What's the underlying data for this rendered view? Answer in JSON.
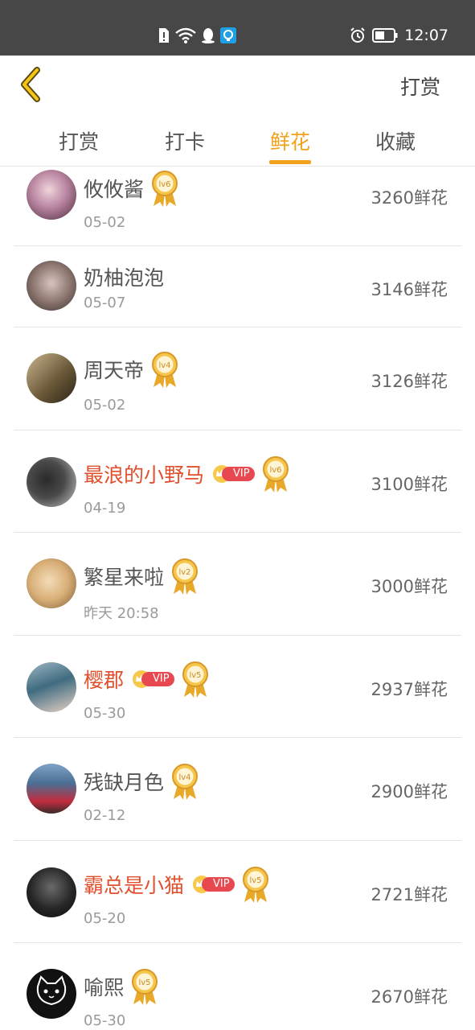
{
  "status_bar": {
    "time": "12:07",
    "icons": [
      "sim-alert-icon",
      "wifi-icon",
      "qq-icon",
      "app-notify-icon",
      "alarm-icon",
      "battery-icon"
    ]
  },
  "topbar": {
    "back_icon": "chevron-left-icon",
    "action_label": "打赏"
  },
  "tabs": [
    {
      "label": "打赏",
      "active": false
    },
    {
      "label": "打卡",
      "active": false
    },
    {
      "label": "鲜花",
      "active": true
    },
    {
      "label": "收藏",
      "active": false
    }
  ],
  "colors": {
    "accent": "#f0a21b",
    "vip_name": "#e0502d",
    "vip_tag": "#e8484f",
    "status_bar": "#474747"
  },
  "rows": [
    {
      "name": "攸攸酱",
      "date": "05-02",
      "amount": "3260鲜花",
      "vip": false,
      "level": "lv6",
      "vip_label": ""
    },
    {
      "name": "奶柚泡泡",
      "date": "05-07",
      "amount": "3146鲜花",
      "vip": false,
      "level": "",
      "vip_label": ""
    },
    {
      "name": "周天帝",
      "date": "05-02",
      "amount": "3126鲜花",
      "vip": false,
      "level": "lv4",
      "vip_label": ""
    },
    {
      "name": "最浪的小野马",
      "date": "04-19",
      "amount": "3100鲜花",
      "vip": true,
      "level": "lv6",
      "vip_label": "VIP"
    },
    {
      "name": "繁星来啦",
      "date": "昨天 20:58",
      "amount": "3000鲜花",
      "vip": false,
      "level": "lv2",
      "vip_label": ""
    },
    {
      "name": "樱郡",
      "date": "05-30",
      "amount": "2937鲜花",
      "vip": true,
      "level": "lv5",
      "vip_label": "VIP"
    },
    {
      "name": "残缺月色",
      "date": "02-12",
      "amount": "2900鲜花",
      "vip": false,
      "level": "lv4",
      "vip_label": ""
    },
    {
      "name": "霸总是小猫",
      "date": "05-20",
      "amount": "2721鲜花",
      "vip": true,
      "level": "lv5",
      "vip_label": "VIP"
    },
    {
      "name": "喻熙",
      "date": "05-30",
      "amount": "2670鲜花",
      "vip": false,
      "level": "lv5",
      "vip_label": ""
    }
  ]
}
